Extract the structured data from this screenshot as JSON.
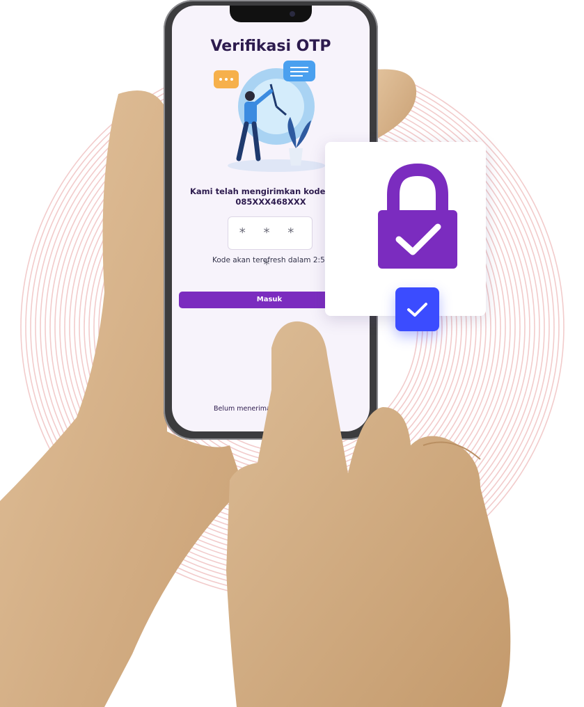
{
  "screen": {
    "title": "Verifikasi OTP",
    "sent_message": "Kami telah mengirimkan kode O",
    "phone_number": "085XXX468XXX",
    "otp_placeholder": "* * * *",
    "refresh_text": "Kode akan terefresh dalam 2:58",
    "login_button": "Masuk",
    "resend_text": "Belum menerima k"
  },
  "icons": {
    "lock": "lock-check-icon",
    "badge": "checkmark-icon",
    "chat": "chat-bubble-icon"
  },
  "colors": {
    "primary": "#7b2cbf",
    "badge": "#3b4cff",
    "rings": "#e8a0a0",
    "skin": "#d6b28a"
  }
}
